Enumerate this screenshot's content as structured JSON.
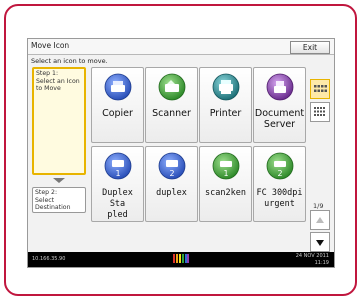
{
  "window": {
    "title": "Move Icon",
    "exit_label": "Exit",
    "instruction": "Select an icon to move."
  },
  "steps": [
    {
      "lines": [
        "Step 1:",
        "Select an Icon",
        "to Move"
      ],
      "state": "active"
    },
    {
      "lines": [
        "Step 2:",
        "Select Destination"
      ],
      "state": "inactive"
    }
  ],
  "tiles_row1": [
    {
      "label_lines": [
        "Copier"
      ],
      "icon": "copier-icon",
      "color": "#3b63c6"
    },
    {
      "label_lines": [
        "Scanner"
      ],
      "icon": "scanner-icon",
      "color": "#3c9a35"
    },
    {
      "label_lines": [
        "Printer"
      ],
      "icon": "printer-icon",
      "color": "#24878e"
    },
    {
      "label_lines": [
        "Document",
        "Server"
      ],
      "icon": "document-server-icon",
      "color": "#7c3f9e"
    }
  ],
  "tiles_row2": [
    {
      "label_lines": [
        "Duplex Sta",
        "pled"
      ],
      "icon": "copier-program-icon",
      "badge": "1",
      "color": "#3b63c6"
    },
    {
      "label_lines": [
        "duplex"
      ],
      "icon": "copier-program-icon",
      "badge": "2",
      "color": "#3b63c6"
    },
    {
      "label_lines": [
        "scan2ken"
      ],
      "icon": "scanner-program-icon",
      "badge": "1",
      "color": "#3c9a35"
    },
    {
      "label_lines": [
        "FC 300dpi",
        "urgent"
      ],
      "icon": "scanner-program-icon",
      "badge": "2",
      "color": "#3c9a35"
    }
  ],
  "view_buttons": [
    {
      "icon": "grid-view-large-icon",
      "state": "active"
    },
    {
      "icon": "grid-view-small-icon",
      "state": "inactive"
    }
  ],
  "pagination": {
    "indicator": "1/9"
  },
  "status": {
    "ip": "10.166.35.90",
    "date": "24 NOV 2011",
    "time": "11:19",
    "brand_logo": "RICOH"
  },
  "colors": {
    "frame": "#c0163e",
    "active_step_border": "#e8b400",
    "status_bar": "#000000"
  }
}
